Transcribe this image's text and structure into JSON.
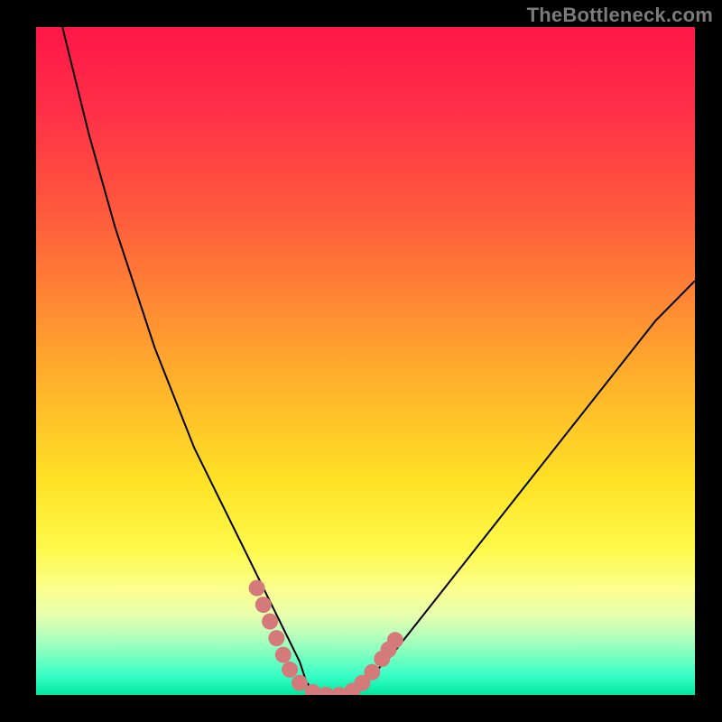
{
  "watermark": "TheBottleneck.com",
  "chart_data": {
    "type": "line",
    "title": "",
    "xlabel": "",
    "ylabel": "",
    "xlim": [
      0,
      100
    ],
    "ylim": [
      0,
      100
    ],
    "series": [
      {
        "name": "bottleneck-curve",
        "x": [
          4,
          6,
          8,
          10,
          12,
          14,
          16,
          18,
          20,
          22,
          24,
          26,
          28,
          30,
          32,
          34,
          36,
          38,
          40,
          41,
          42,
          44,
          46,
          48,
          50,
          54,
          58,
          62,
          66,
          70,
          74,
          78,
          82,
          86,
          90,
          94,
          98,
          100
        ],
        "y": [
          100,
          92,
          84,
          77,
          70,
          64,
          58,
          52,
          47,
          42,
          37,
          33,
          29,
          25,
          21,
          17,
          13,
          9,
          5,
          2,
          0.5,
          0,
          0,
          0.5,
          2,
          6,
          11,
          16,
          21,
          26,
          31,
          36,
          41,
          46,
          51,
          56,
          60,
          62
        ],
        "color": "#000000",
        "width": 2
      }
    ],
    "annotations": [
      {
        "name": "valley-markers",
        "color": "#d57a7a",
        "points": [
          {
            "x": 33.5,
            "y": 16
          },
          {
            "x": 34.5,
            "y": 13.5
          },
          {
            "x": 35.5,
            "y": 11
          },
          {
            "x": 36.5,
            "y": 8.5
          },
          {
            "x": 37.5,
            "y": 6
          },
          {
            "x": 38.5,
            "y": 3.8
          },
          {
            "x": 40,
            "y": 1.8
          },
          {
            "x": 42,
            "y": 0.4
          },
          {
            "x": 44,
            "y": 0
          },
          {
            "x": 46,
            "y": 0
          },
          {
            "x": 48,
            "y": 0.6
          },
          {
            "x": 49.5,
            "y": 1.8
          },
          {
            "x": 51,
            "y": 3.4
          },
          {
            "x": 52.5,
            "y": 5.4
          },
          {
            "x": 53.5,
            "y": 6.8
          },
          {
            "x": 54.5,
            "y": 8.2
          }
        ]
      }
    ]
  }
}
